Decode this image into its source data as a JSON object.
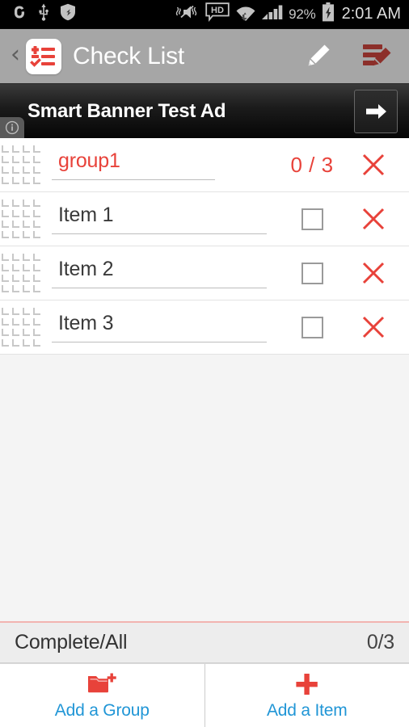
{
  "status_bar": {
    "icons_left": [
      "sigma-app-icon",
      "usb-icon",
      "shield-sync-icon"
    ],
    "icons_right": [
      "vibrate-mute-icon",
      "hd-icon",
      "wifi-icon",
      "signal-icon"
    ],
    "battery_percent": "92%",
    "battery_state": "charging",
    "time": "2:01 AM"
  },
  "action_bar": {
    "back_label": "‹",
    "app_icon": "checklist-app-icon",
    "title": "Check List",
    "edit_icon": "pencil-icon",
    "edit_list_icon": "edit-list-icon",
    "bg_color": "#a6a6a6"
  },
  "ad": {
    "text": "Smart Banner Test Ad",
    "cta_icon": "arrow-right-icon",
    "info_icon": "info-icon"
  },
  "list": {
    "group": {
      "name": "group1",
      "counter": "0 / 3",
      "delete_icon": "close-icon",
      "color": "#e8423a"
    },
    "items": [
      {
        "name": "Item 1",
        "checked": false
      },
      {
        "name": "Item 2",
        "checked": false
      },
      {
        "name": "Item 3",
        "checked": false
      }
    ]
  },
  "summary": {
    "label": "Complete/All",
    "value": "0/3"
  },
  "bottom_bar": {
    "add_group": {
      "label": "Add a Group",
      "icon": "folder-plus-icon"
    },
    "add_item": {
      "label": "Add a Item",
      "icon": "plus-icon"
    },
    "label_color": "#2196d6",
    "icon_color": "#e8423a"
  }
}
